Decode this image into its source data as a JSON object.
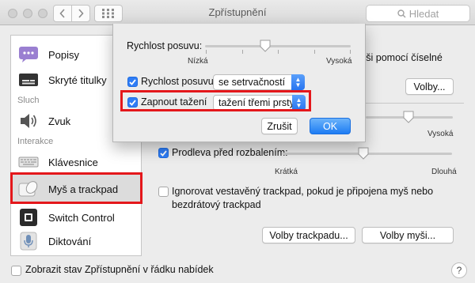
{
  "window": {
    "title": "Zpřístupnění",
    "search_placeholder": "Hledat"
  },
  "sidebar": {
    "items": [
      {
        "label": "Popisy"
      },
      {
        "label": "Skryté titulky"
      },
      {
        "label": "Zvuk"
      },
      {
        "label": "Klávesnice"
      },
      {
        "label": "Myš a trackpad"
      },
      {
        "label": "Switch Control"
      },
      {
        "label": "Diktování"
      }
    ],
    "sections": {
      "hearing": "Sluch",
      "interaction": "Interakce"
    }
  },
  "main": {
    "partial_text": "yši pomocí číselné",
    "options_button": "Volby...",
    "slider_right_label": "Vysoká",
    "spring_delay_label": "Prodleva před rozbalením:",
    "spring_delay_min": "Krátká",
    "spring_delay_max": "Dlouhá",
    "ignore_trackpad_text": "Ignorovat vestavěný trackpad, pokud je připojena myš nebo bezdrátový trackpad",
    "trackpad_options_button": "Volby trackpadu...",
    "mouse_options_button": "Volby myši..."
  },
  "sheet": {
    "scroll_speed_label": "Rychlost posuvu:",
    "scroll_min": "Nízká",
    "scroll_max": "Vysoká",
    "scrolling_checkbox_label": "Rychlost posuvu",
    "scrolling_value": "se setrvačností",
    "dragging_checkbox_label": "Zapnout tažení",
    "dragging_value": "tažení třemi prsty",
    "cancel": "Zrušit",
    "ok": "OK"
  },
  "footer": {
    "show_status_label": "Zobrazit stav Zpřístupnění v řádku nabídek",
    "help": "?"
  },
  "colors": {
    "accent": "#2f7df6",
    "highlight": "#e4171b"
  }
}
